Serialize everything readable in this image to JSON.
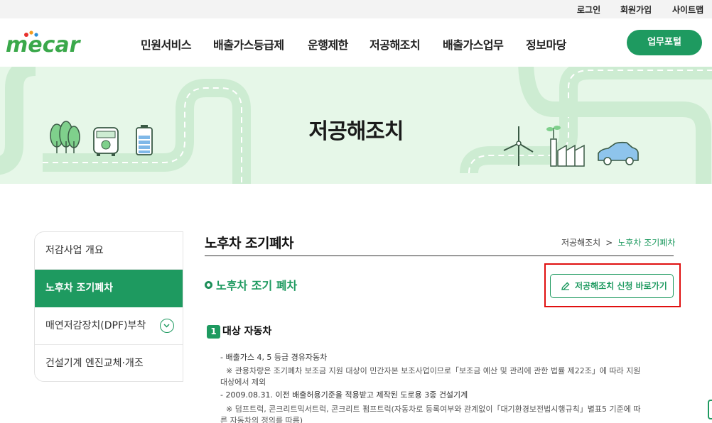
{
  "utility": {
    "login": "로그인",
    "join": "회원가입",
    "sitemap": "사이트맵"
  },
  "header": {
    "logo_text": "mecar",
    "nav": [
      "민원서비스",
      "배출가스등급제",
      "운행제한",
      "저공해조치",
      "배출가스업무",
      "정보마당"
    ],
    "portal_button": "업무포털"
  },
  "banner": {
    "title": "저공해조치"
  },
  "sidebar": {
    "items": [
      {
        "label": "저감사업 개요"
      },
      {
        "label": "노후차 조기폐차"
      },
      {
        "label": "매연저감장치(DPF)부착"
      },
      {
        "label": "건설기계 엔진교체·개조"
      }
    ]
  },
  "content": {
    "title": "노후차 조기폐차",
    "breadcrumb": {
      "parent": "저공해조치",
      "separator": ">",
      "current": "노후차 조기폐차"
    },
    "section_heading": "노후차 조기 폐차",
    "apply_button": "저공해조치 신청 바로가기",
    "subsection": {
      "number": "1",
      "label": "대상 자동차"
    },
    "lines": [
      "- 배출가스 4, 5 등급 경유자동차",
      "※ 관용차량은 조기폐차 보조금 지원 대상이 민간자본 보조사업이므로「보조금 예산 및 관리에 관한 법률 제22조」에 따라 지원",
      "대상에서 제외",
      "- 2009.08.31. 이전 배출허용기준을 적용받고 제작된 도로용 3종 건설기계",
      "※ 덤프트럭, 콘크리트믹서트럭, 콘크리트 펌프트럭(자동차로 등록여부와 관계없이「대기환경보전법시행규칙」별표5 기준에 따",
      "른 자동차의 정의를 따름)"
    ]
  },
  "colors": {
    "brand_green": "#1e9a60",
    "banner_bg": "#e6f7e8",
    "highlight_red": "#e01010"
  },
  "icons": {
    "apply_button": "pencil-icon",
    "sidebar_expand": "chevron-down-icon",
    "section_bullet": "ring-bullet-icon"
  }
}
